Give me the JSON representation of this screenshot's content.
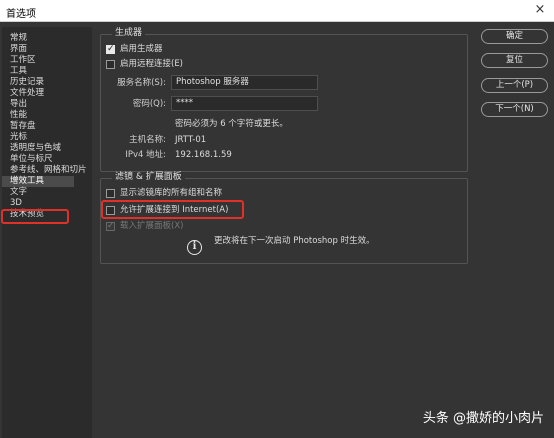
{
  "window": {
    "title": "首选项",
    "close_glyph": "×"
  },
  "sidebar": {
    "items": [
      {
        "label": "常规"
      },
      {
        "label": "界面"
      },
      {
        "label": "工作区"
      },
      {
        "label": "工具"
      },
      {
        "label": "历史记录"
      },
      {
        "label": "文件处理"
      },
      {
        "label": "导出"
      },
      {
        "label": "性能"
      },
      {
        "label": "暂存盘"
      },
      {
        "label": "光标"
      },
      {
        "label": "透明度与色域"
      },
      {
        "label": "单位与标尺"
      },
      {
        "label": "参考线、网格和切片"
      },
      {
        "label": "增效工具",
        "selected": true
      },
      {
        "label": "文字"
      },
      {
        "label": "3D"
      },
      {
        "label": "技术预览"
      }
    ]
  },
  "generator": {
    "legend": "生成器",
    "enable_generator": {
      "label": "启用生成器",
      "checked": true
    },
    "enable_remote": {
      "label": "启用远程连接(E)",
      "checked": false
    },
    "service_name": {
      "label": "服务名称(S):",
      "value": "Photoshop 服务器"
    },
    "password": {
      "label": "密码(Q):",
      "value": "****"
    },
    "password_hint": "密码必须为 6 个字符或更长。",
    "host_name": {
      "label": "主机名称:",
      "value": "JRTT-01"
    },
    "ipv4": {
      "label": "IPv4 地址:",
      "value": "192.168.1.59"
    }
  },
  "filters": {
    "legend": "滤镜 & 扩展面板",
    "show_all_groups": {
      "label": "显示滤镜库的所有组和名称",
      "checked": false
    },
    "allow_internet": {
      "label": "允许扩展连接到 Internet(A)",
      "checked": false
    },
    "load_panels": {
      "label": "载入扩展面板(X)",
      "checked": true,
      "disabled": true
    },
    "notice": "更改将在下一次启动 Photoshop 时生效。",
    "notice_icon": "info-icon"
  },
  "buttons": {
    "ok": "确定",
    "reset": "复位",
    "prev": "上一个(P)",
    "next": "下一个(N)"
  },
  "watermark": "头条 @撒娇的小肉片",
  "colors": {
    "dialog_bg": "#343434",
    "sidebar_bg": "#2b2b2b",
    "highlight_red": "#e0302a",
    "selected_bg": "#4b4b4b"
  }
}
